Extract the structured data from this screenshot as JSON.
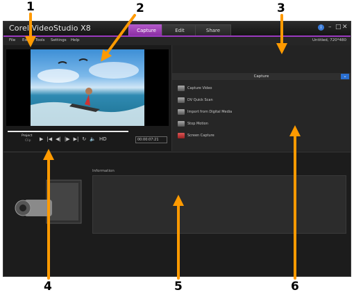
{
  "window": {
    "title": "Corel VideoStudio X8",
    "project_info": "Untitled, 720*480"
  },
  "tabs": [
    {
      "label": "Capture",
      "active": true
    },
    {
      "label": "Edit",
      "active": false
    },
    {
      "label": "Share",
      "active": false
    }
  ],
  "menu": [
    "File",
    "Edit",
    "Tools",
    "Settings",
    "Help"
  ],
  "player": {
    "project_label": "Project",
    "clip_label": "Clip",
    "hd_label": "HD",
    "timecode": "00:00:07:21"
  },
  "capture_panel": {
    "header": "Capture",
    "options": [
      {
        "label": "Capture Video",
        "icon": "video-camera-icon"
      },
      {
        "label": "DV Quick Scan",
        "icon": "dv-scan-icon"
      },
      {
        "label": "Import from Digital Media",
        "icon": "import-media-icon"
      },
      {
        "label": "Stop Motion",
        "icon": "stop-motion-icon"
      },
      {
        "label": "Screen Capture",
        "icon": "screen-capture-icon"
      }
    ]
  },
  "information": {
    "label": "Information"
  },
  "annotations": [
    "1",
    "2",
    "3",
    "4",
    "5",
    "6"
  ],
  "colors": {
    "accent_purple": "#9b3ac0",
    "annotation_arrow": "#ff9a00"
  }
}
